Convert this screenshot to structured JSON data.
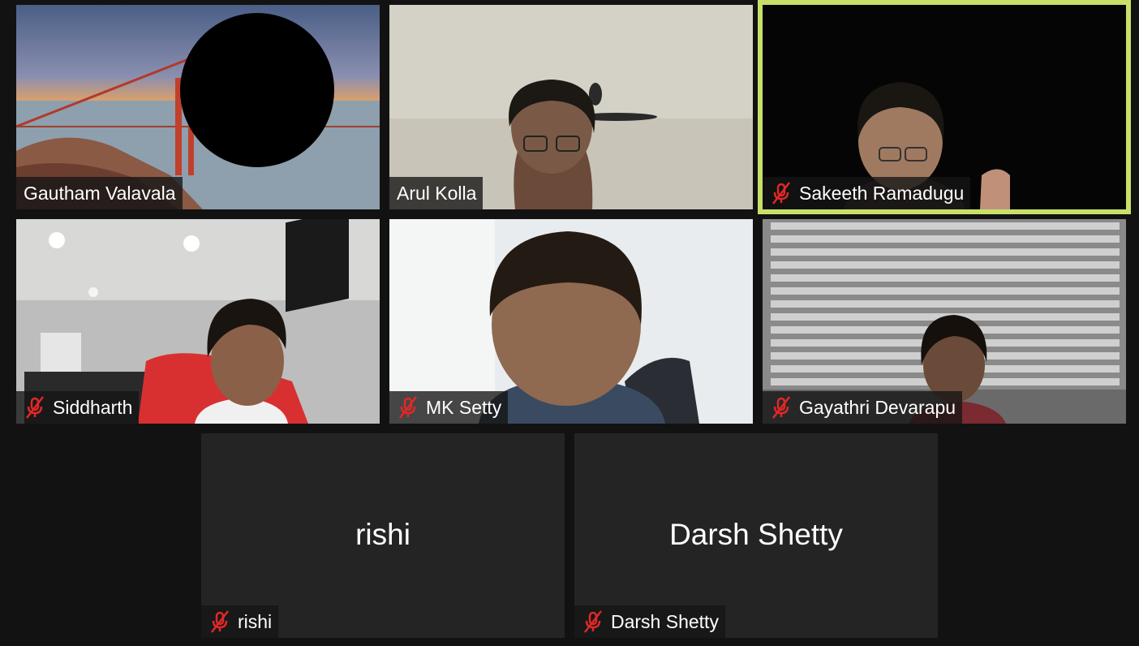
{
  "colors": {
    "background": "#121212",
    "tile_empty": "#242424",
    "active_speaker_border": "#c8e06a",
    "muted_icon": "#e02828"
  },
  "participants": [
    {
      "name": "Gautham Valavala",
      "muted": false,
      "video": "virtual-background-golden-gate-bridge"
    },
    {
      "name": "Arul Kolla",
      "muted": false,
      "video": "webcam"
    },
    {
      "name": "Sakeeth Ramadugu",
      "muted": true,
      "video": "webcam",
      "active_speaker": true
    },
    {
      "name": "Siddharth",
      "muted": true,
      "video": "webcam"
    },
    {
      "name": "MK Setty",
      "muted": true,
      "video": "webcam"
    },
    {
      "name": "Gayathri Devarapu",
      "muted": true,
      "video": "webcam"
    },
    {
      "name": "rishi",
      "muted": true,
      "video": "off"
    },
    {
      "name": "Darsh Shetty",
      "muted": true,
      "video": "off"
    }
  ],
  "icons": {
    "muted": "mic-muted-icon"
  }
}
